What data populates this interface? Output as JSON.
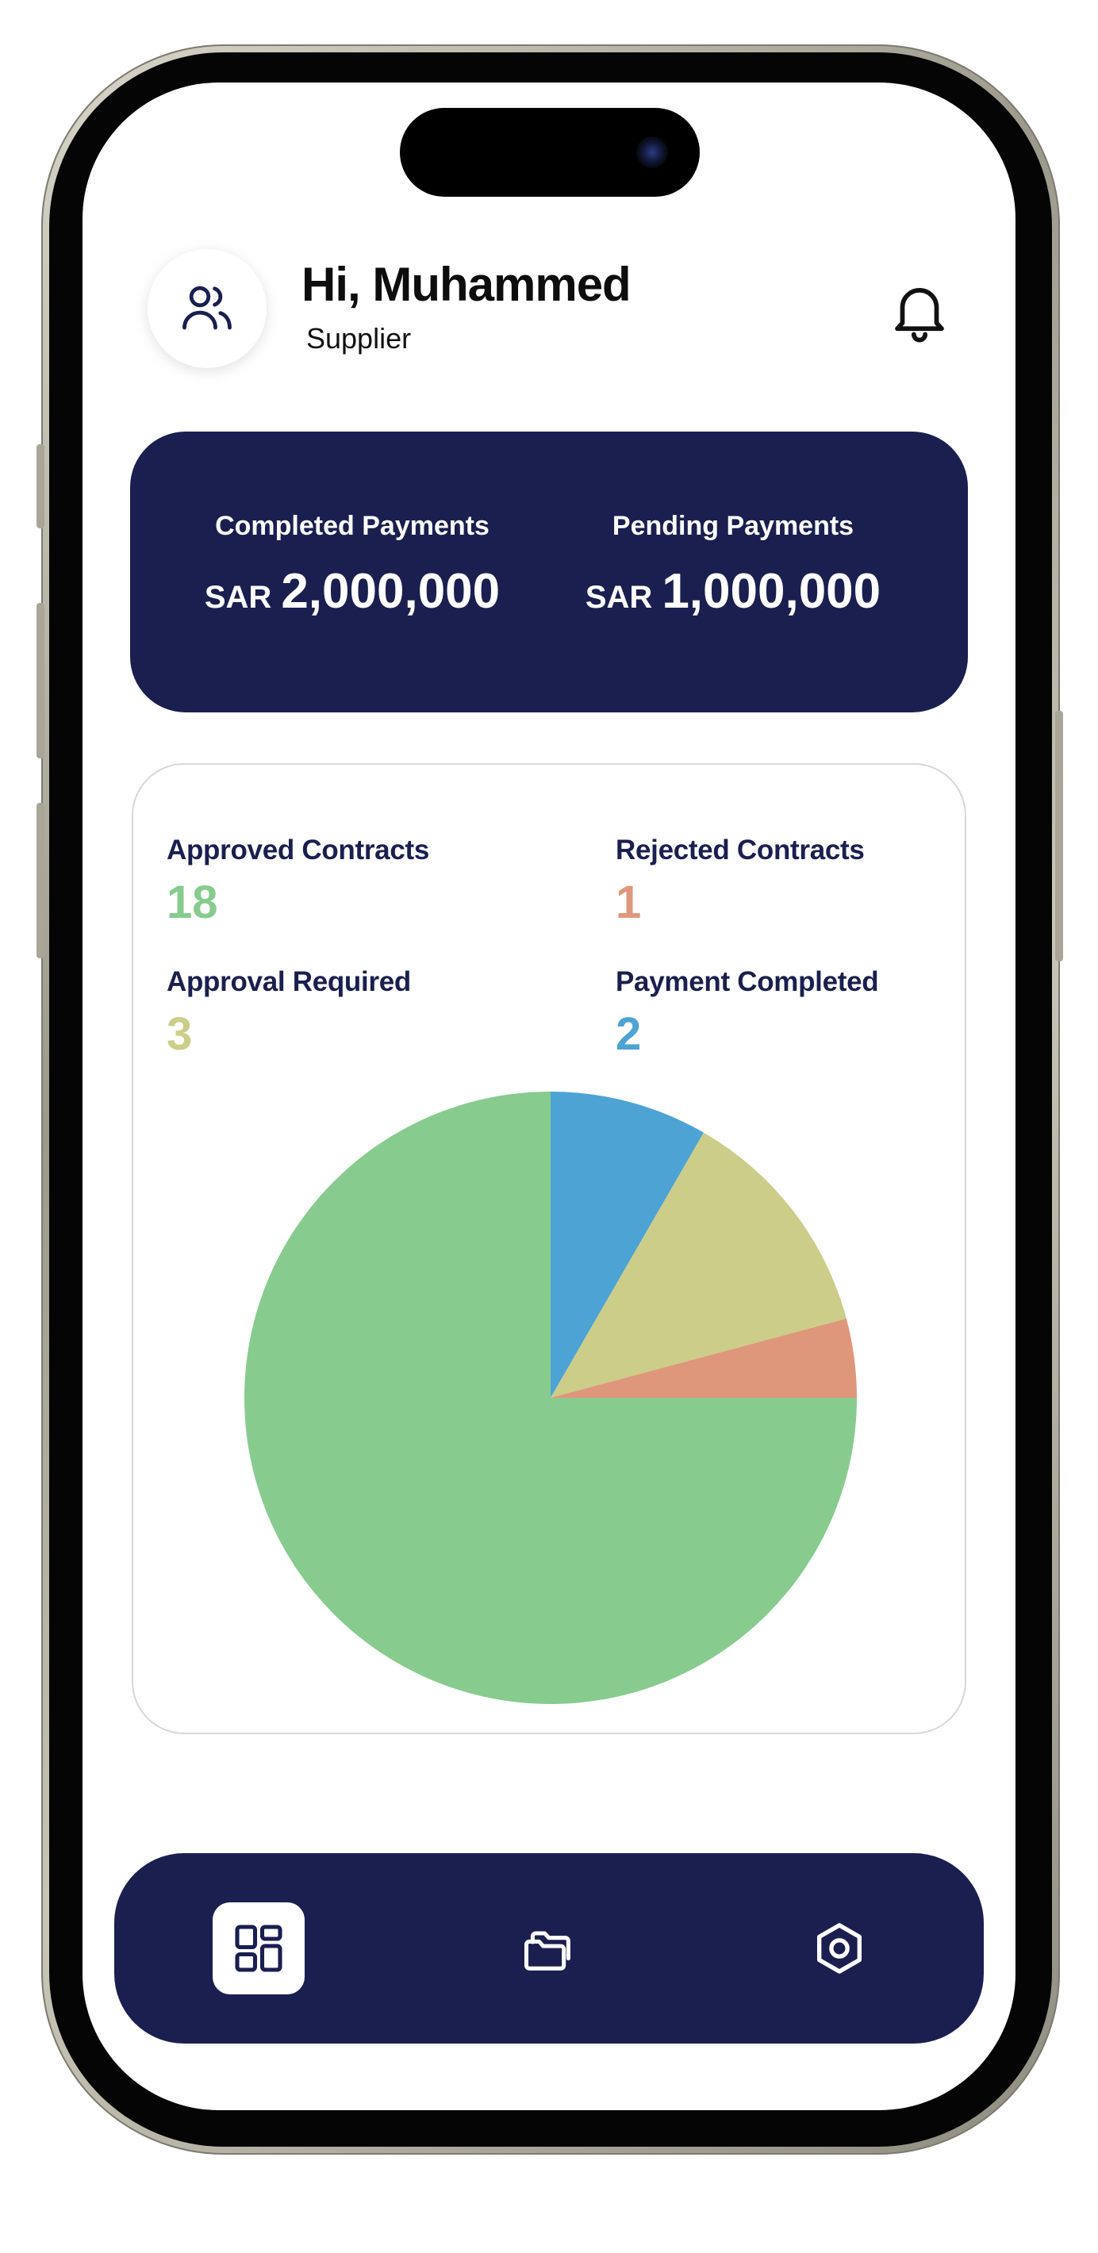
{
  "header": {
    "greeting": "Hi, Muhammed",
    "role": "Supplier",
    "avatar_icon": "users-icon",
    "notification_icon": "bell-icon"
  },
  "payments": {
    "completed": {
      "label": "Completed Payments",
      "currency": "SAR",
      "amount": "2,000,000"
    },
    "pending": {
      "label": "Pending Payments",
      "currency": "SAR",
      "amount": "1,000,000"
    }
  },
  "contracts": {
    "approved": {
      "label": "Approved Contracts",
      "value": "18",
      "color": "#88cb8f"
    },
    "rejected": {
      "label": "Rejected Contracts",
      "value": "1",
      "color": "#df977b"
    },
    "approval_required": {
      "label": "Approval Required",
      "value": "3",
      "color": "#cbcd89"
    },
    "payment_completed": {
      "label": "Payment Completed",
      "value": "2",
      "color": "#4ea3d5"
    }
  },
  "chart_data": {
    "type": "pie",
    "categories": [
      "Payment Completed",
      "Approval Required",
      "Rejected Contracts",
      "Approved Contracts"
    ],
    "values": [
      2,
      3,
      1,
      18
    ],
    "colors": [
      "#4ea3d5",
      "#cbcd89",
      "#df977b",
      "#88cb8f"
    ],
    "start_angle": "12 o'clock",
    "direction": "clockwise"
  },
  "nav": {
    "items": [
      {
        "icon": "dashboard-icon",
        "active": true
      },
      {
        "icon": "folders-icon",
        "active": false
      },
      {
        "icon": "settings-icon",
        "active": false
      }
    ],
    "active_color": "#ffffff",
    "background": "#1a1f4f"
  }
}
